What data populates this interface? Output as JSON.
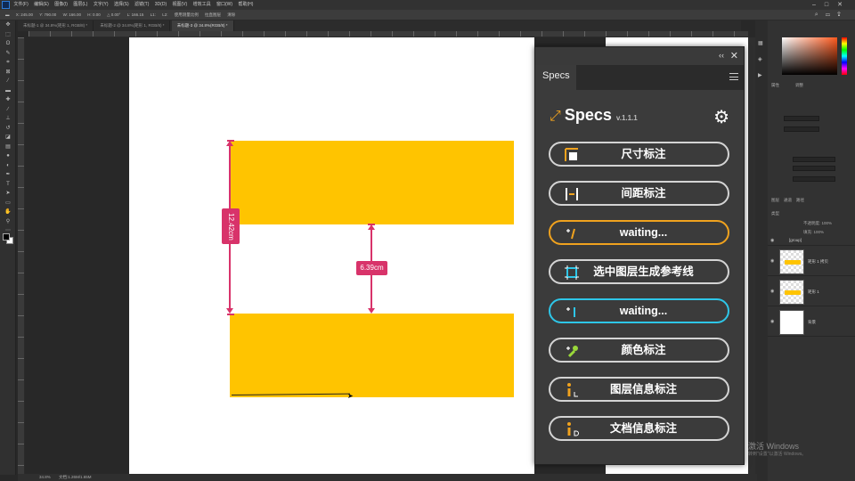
{
  "menubar": {
    "items": [
      "文件(F)",
      "编辑(E)",
      "图像(I)",
      "图层(L)",
      "文字(Y)",
      "选择(S)",
      "滤镜(T)",
      "3D(D)",
      "视图(V)",
      "增效工具",
      "窗口(W)",
      "帮助(H)"
    ]
  },
  "options_bar": {
    "fields": [
      "X: 245.00",
      "Y: 790.00",
      "W: 166.00",
      "H: 0.00",
      "△ 0.00°",
      "L: 166.15",
      "L1:",
      "L2:",
      "使用测量比例",
      "拉直图层",
      "清除"
    ]
  },
  "tabs": [
    {
      "label": "未标题-1 @ 34.8%(矩形 1, RGB/8) *",
      "active": false
    },
    {
      "label": "未标题-2 @ 34.8%(矩形 1, RGB/8) *",
      "active": false
    },
    {
      "label": "未标题-3 @ 34.8%(RGB/8) *",
      "active": true
    }
  ],
  "status": {
    "zoom": "34.8%",
    "doc": "文档:1.26M/1.65M"
  },
  "canvas": {
    "dimensions": [
      {
        "label": "12.42cm",
        "orientation": "vertical"
      },
      {
        "label": "6.39cm",
        "orientation": "vertical"
      }
    ],
    "colors": {
      "shape": "#ffc400",
      "marker": "#d8336a"
    }
  },
  "specs_panel": {
    "tab": "Specs",
    "brand_name": "Specs",
    "version": "v.1.1.1",
    "buttons": [
      {
        "label": "尺寸标注",
        "icon": "size-mark-icon",
        "state": "normal"
      },
      {
        "label": "间距标注",
        "icon": "spacing-mark-icon",
        "state": "normal"
      },
      {
        "label": "waiting...",
        "icon": "orange-plus-icon",
        "state": "orange"
      },
      {
        "label": "选中图层生成参考线",
        "icon": "guide-icon",
        "state": "normal"
      },
      {
        "label": "waiting...",
        "icon": "cyan-plus-icon",
        "state": "cyan"
      },
      {
        "label": "颜色标注",
        "icon": "eyedropper-icon",
        "state": "normal"
      },
      {
        "label": "图层信息标注",
        "icon": "layer-info-icon",
        "state": "normal"
      },
      {
        "label": "文档信息标注",
        "icon": "doc-info-icon",
        "state": "normal"
      }
    ],
    "accent_orange": "#f0a21e",
    "accent_cyan": "#2ec6e8"
  },
  "right_panels": {
    "properties_tab": "属性",
    "adjust_tab": "调整",
    "layers_tab": "图层",
    "channels_tab": "通道",
    "paths_tab": "路径",
    "kind_label": "类型",
    "opacity_label": "不透明度: 100%",
    "fill_label": "填充: 100%",
    "group_name": "[group]",
    "layers": [
      "矩形 1 拷贝",
      "矩形 1",
      "背景"
    ]
  },
  "watermark": {
    "line1": "激活 Windows",
    "line2": "转到\"设置\"以激活 Windows。"
  }
}
